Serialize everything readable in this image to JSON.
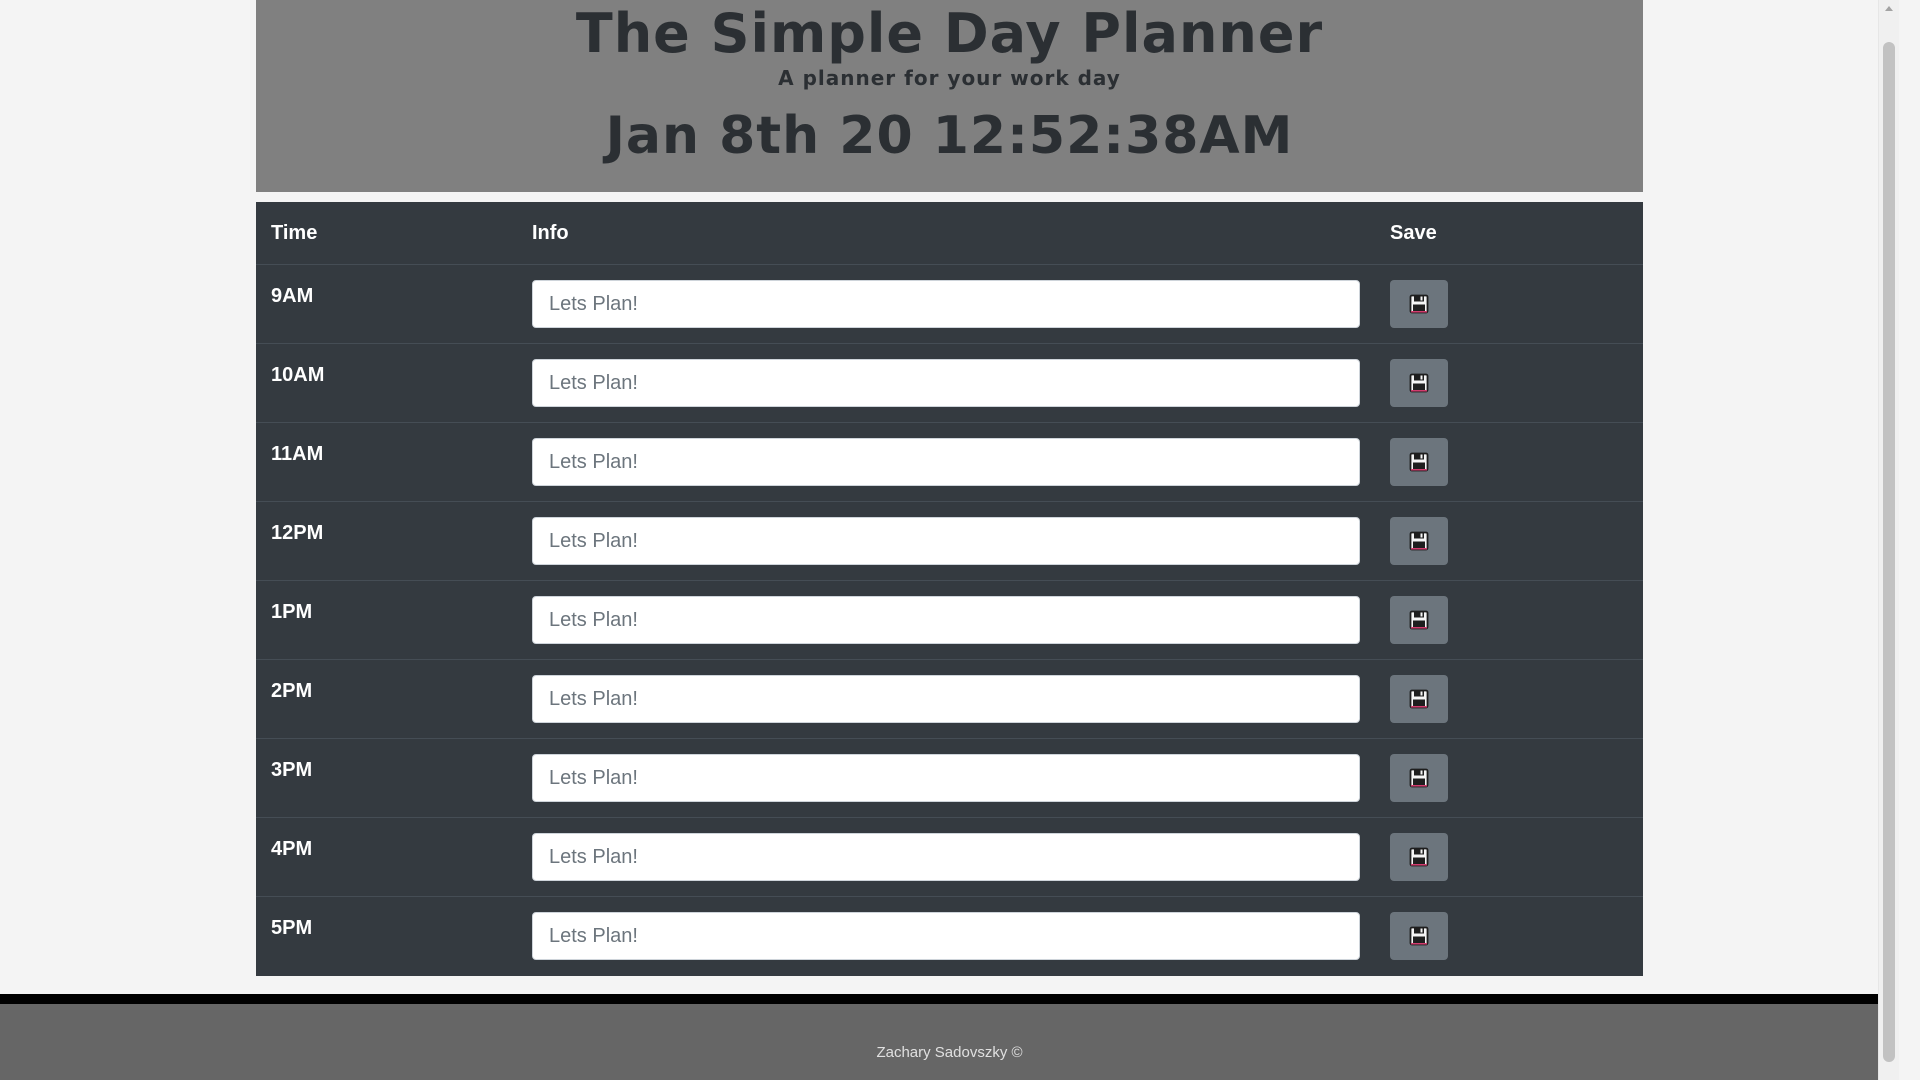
{
  "header": {
    "title": "The Simple Day Planner",
    "subtitle": "A planner for your work day",
    "clock": "Jan 8th 20 12:52:38AM"
  },
  "table": {
    "columns": {
      "time": "Time",
      "info": "Info",
      "save": "Save"
    },
    "rows": [
      {
        "hour": "9AM",
        "placeholder": "Lets Plan!"
      },
      {
        "hour": "10AM",
        "placeholder": "Lets Plan!"
      },
      {
        "hour": "11AM",
        "placeholder": "Lets Plan!"
      },
      {
        "hour": "12PM",
        "placeholder": "Lets Plan!"
      },
      {
        "hour": "1PM",
        "placeholder": "Lets Plan!"
      },
      {
        "hour": "2PM",
        "placeholder": "Lets Plan!"
      },
      {
        "hour": "3PM",
        "placeholder": "Lets Plan!"
      },
      {
        "hour": "4PM",
        "placeholder": "Lets Plan!"
      },
      {
        "hour": "5PM",
        "placeholder": "Lets Plan!"
      }
    ],
    "save_icon": "floppy-disk-icon"
  },
  "footer": {
    "credit": "Zachary Sadovszky ©"
  },
  "colors": {
    "jumbotron_bg": "#808080",
    "table_bg": "#343a40",
    "save_button_bg": "#6c757d",
    "footer_bg": "#666666",
    "footer_bar": "#000000"
  }
}
